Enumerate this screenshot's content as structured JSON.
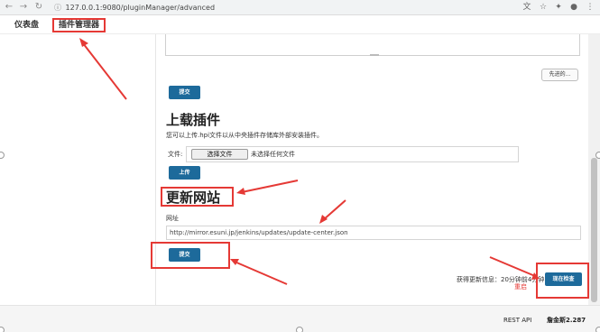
{
  "browser": {
    "back_icon": "arrow-left-icon",
    "forward_icon": "arrow-right-icon",
    "reload_icon": "reload-icon",
    "url": "127.0.0.1:9080/pluginManager/advanced"
  },
  "nav": {
    "dashboard": "仪表盘",
    "plugin_manager": "插件管理器"
  },
  "settings": {
    "advanced_button": "先进的...",
    "submit_label": "提交"
  },
  "upload": {
    "title": "上载插件",
    "help": "您可以上传.hpi文件以从中央插件存储库外部安装插件。",
    "file_label": "文件:",
    "choose_file": "选择文件",
    "no_file": "未选择任何文件",
    "upload_button": "上传"
  },
  "update_site": {
    "title": "更新网站",
    "url_label": "网址",
    "url_value": "http://mirror.esuni.jp/jenkins/updates/update-center.json",
    "submit_label": "提交"
  },
  "status": {
    "info_text": "获得更新信息：20分钟前4分钟",
    "red_note": "重启",
    "check_now_button": "现在检查"
  },
  "footer": {
    "rest_api": "REST API",
    "version": "詹金斯2.287"
  },
  "colors": {
    "accent": "#1d6a9b",
    "highlight": "#e53935"
  }
}
